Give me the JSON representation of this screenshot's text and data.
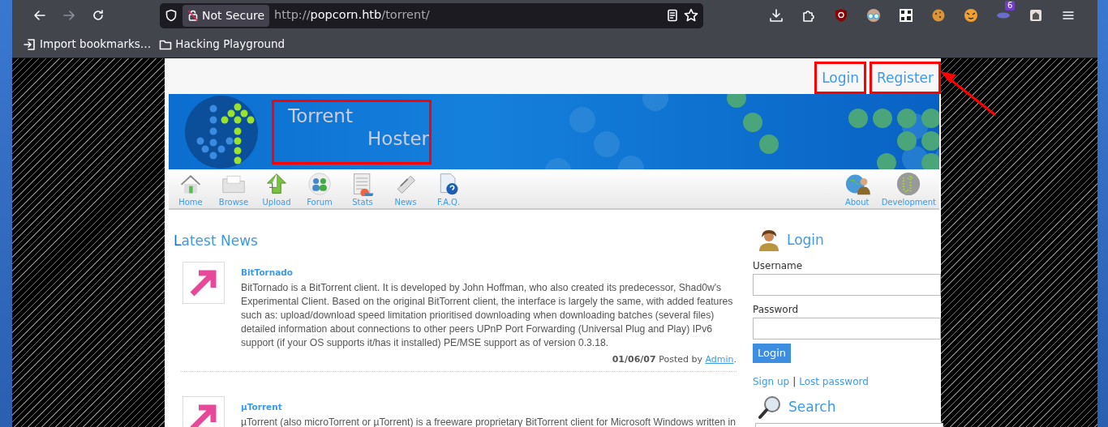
{
  "browser": {
    "security_label": "Not Secure",
    "url_scheme": "http://",
    "url_host": "popcorn.htb",
    "url_path": "/torrent/",
    "extension_badge": "6",
    "bookmarks": [
      "Import bookmarks…",
      "Hacking Playground"
    ]
  },
  "top_links": [
    {
      "label": "Login",
      "highlighted": true
    },
    {
      "label": "Register",
      "highlighted": true
    }
  ],
  "banner": {
    "title_line1": "Torrent",
    "title_line2": "Hoster",
    "highlighted": true
  },
  "annotation_arrow": true,
  "nav": {
    "left": [
      "Home",
      "Browse",
      "Upload",
      "Forum",
      "Stats",
      "News",
      "F.A.Q."
    ],
    "right": [
      "About",
      "Development"
    ]
  },
  "news": {
    "heading": "Latest News",
    "items": [
      {
        "title": "BitTornado",
        "body": "BitTornado is a BitTorrent client. It is developed by John Hoffman, who also created its predecessor, Shad0w's Experimental Client. Based on the original BitTorrent client, the interface is largely the same, with added features such as: upload/download speed limitation prioritised downloading when downloading batches (several files) detailed information about connections to other peers UPnP Port Forwarding (Universal Plug and Play) IPv6 support (if your OS supports it/has it installed) PE/MSE support as of version 0.3.18.",
        "date": "01/06/07",
        "posted_by": "Posted by",
        "author": "Admin",
        "end": "."
      },
      {
        "title": "µTorrent",
        "body": "µTorrent (also microTorrent or µTorrent) is a freeware proprietary BitTorrent client for Microsoft Windows written in"
      }
    ]
  },
  "login": {
    "title": "Login",
    "username_label": "Username",
    "password_label": "Password",
    "button": "Login",
    "signup": "Sign up",
    "separator": "|",
    "lost_password": "Lost password"
  },
  "search": {
    "title": "Search"
  }
}
